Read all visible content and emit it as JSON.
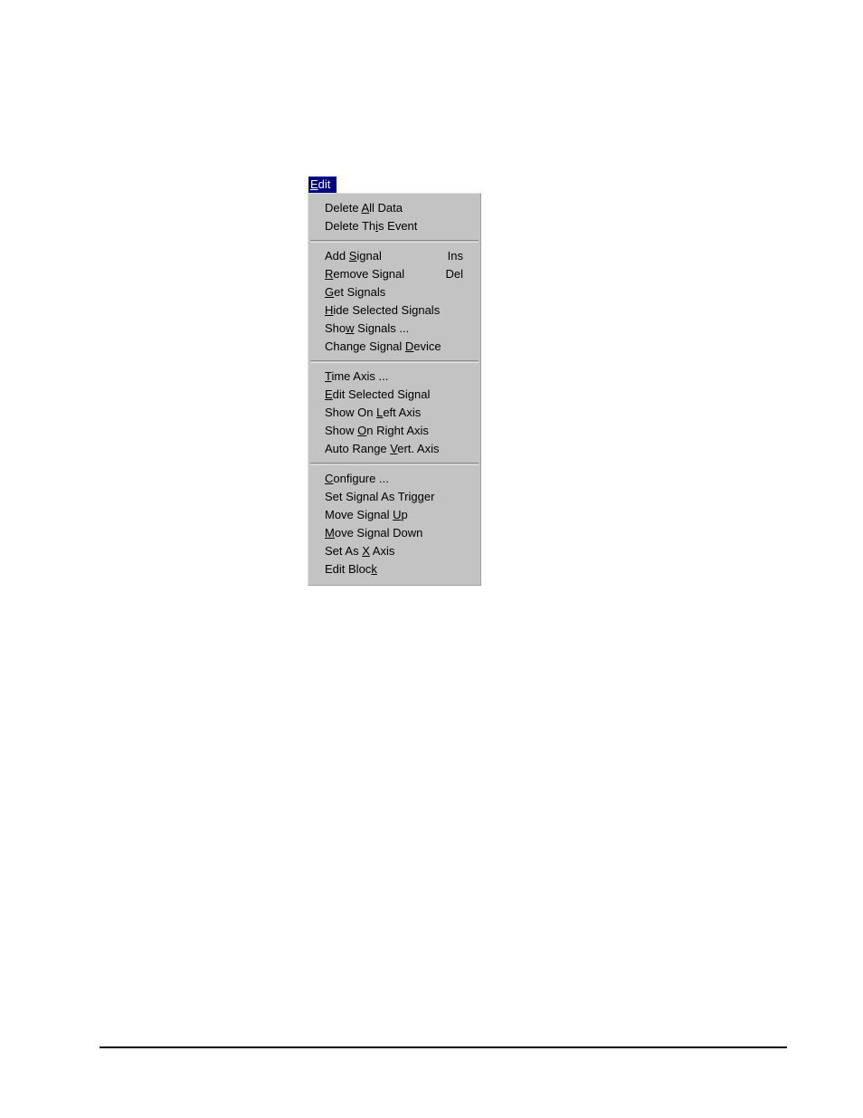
{
  "menu_bar": {
    "title": {
      "text": "Edit",
      "accelerator_char": "E",
      "before": "",
      "after": "dit",
      "background_color": "#000080",
      "text_color": "#ffffff"
    }
  },
  "edit_menu": {
    "background_color": "#c3c3c3",
    "groups": [
      {
        "items": [
          {
            "before": "Delete ",
            "acc": "A",
            "after": "ll Data",
            "full_text": "Delete All Data",
            "shortcut": ""
          },
          {
            "before": "Delete Th",
            "acc": "i",
            "after": "s Event",
            "full_text": "Delete This Event",
            "shortcut": ""
          }
        ]
      },
      {
        "items": [
          {
            "before": "Add ",
            "acc": "S",
            "after": "ignal",
            "full_text": "Add Signal",
            "shortcut": "Ins"
          },
          {
            "before": "",
            "acc": "R",
            "after": "emove Signal",
            "full_text": "Remove Signal",
            "shortcut": "Del"
          },
          {
            "before": "",
            "acc": "G",
            "after": "et Signals",
            "full_text": "Get Signals",
            "shortcut": ""
          },
          {
            "before": "",
            "acc": "H",
            "after": "ide Selected Signals",
            "full_text": "Hide Selected Signals",
            "shortcut": ""
          },
          {
            "before": "Sho",
            "acc": "w",
            "after": " Signals ...",
            "full_text": "Show Signals ...",
            "shortcut": ""
          },
          {
            "before": "Change Signal ",
            "acc": "D",
            "after": "evice",
            "full_text": "Change Signal Device",
            "shortcut": ""
          }
        ]
      },
      {
        "items": [
          {
            "before": "",
            "acc": "T",
            "after": "ime Axis ...",
            "full_text": "Time Axis ...",
            "shortcut": ""
          },
          {
            "before": "",
            "acc": "E",
            "after": "dit Selected Signal",
            "full_text": "Edit Selected Signal",
            "shortcut": ""
          },
          {
            "before": "Show On ",
            "acc": "L",
            "after": "eft Axis",
            "full_text": "Show On Left Axis",
            "shortcut": ""
          },
          {
            "before": "Show ",
            "acc": "O",
            "after": "n Right Axis",
            "full_text": "Show On Right Axis",
            "shortcut": ""
          },
          {
            "before": "Auto Range ",
            "acc": "V",
            "after": "ert. Axis",
            "full_text": "Auto Range Vert. Axis",
            "shortcut": ""
          }
        ]
      },
      {
        "items": [
          {
            "before": "",
            "acc": "C",
            "after": "onfigure ...",
            "full_text": "Configure ...",
            "shortcut": ""
          },
          {
            "before": "Set Si",
            "acc": "g",
            "after": "nal As Trigger",
            "full_text": "Set Signal As Trigger",
            "shortcut": ""
          },
          {
            "before": "Move Signal ",
            "acc": "U",
            "after": "p",
            "full_text": "Move Signal Up",
            "shortcut": ""
          },
          {
            "before": "",
            "acc": "M",
            "after": "ove Signal Down",
            "full_text": "Move Signal Down",
            "shortcut": ""
          },
          {
            "before": "Set As ",
            "acc": "X",
            "after": " Axis",
            "full_text": "Set As X Axis",
            "shortcut": ""
          },
          {
            "before": "Edit Bloc",
            "acc": "k",
            "after": "",
            "full_text": "Edit Block",
            "shortcut": ""
          }
        ]
      }
    ]
  }
}
